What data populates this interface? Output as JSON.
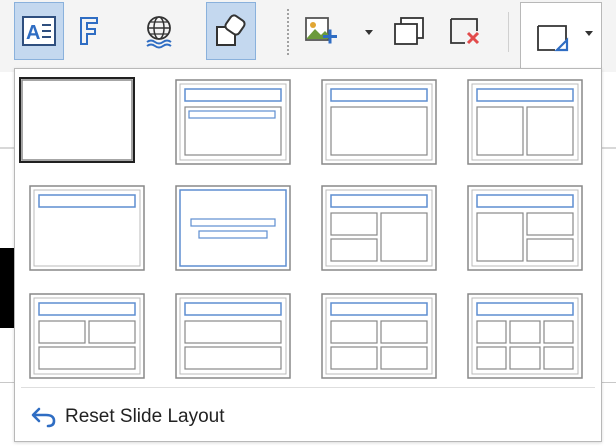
{
  "toolbar": {
    "buttons": [
      {
        "icon": "text-box-icon",
        "active": true
      },
      {
        "icon": "fontwork-icon",
        "active": false
      },
      {
        "icon": "web-globe-icon",
        "active": false
      },
      {
        "icon": "shapes-icon",
        "active": true
      },
      {
        "icon": "insert-image-icon",
        "active": false,
        "has_dropdown": true
      },
      {
        "icon": "duplicate-slide-icon",
        "active": false
      },
      {
        "icon": "delete-slide-icon",
        "active": false
      },
      {
        "icon": "slide-layout-icon",
        "active": false,
        "has_dropdown": true
      }
    ]
  },
  "colors": {
    "accent": "#2f6dc3",
    "active_bg": "#c4d8ef",
    "layout_border": "#888888",
    "layout_blue": "#5e8ed0"
  },
  "layout_popup": {
    "layouts": [
      {
        "name": "blank-slide",
        "selected": true
      },
      {
        "name": "title-content",
        "selected": false
      },
      {
        "name": "title-content-large",
        "selected": false
      },
      {
        "name": "title-2-content",
        "selected": false
      },
      {
        "name": "title-only",
        "selected": false
      },
      {
        "name": "centered-text",
        "selected": false
      },
      {
        "name": "title-2-content-and-content",
        "selected": false
      },
      {
        "name": "title-content-and-2-content",
        "selected": false
      },
      {
        "name": "title-2-content-over-content",
        "selected": false
      },
      {
        "name": "title-content-over-content",
        "selected": false
      },
      {
        "name": "title-4-content",
        "selected": false
      },
      {
        "name": "title-6-content",
        "selected": false
      }
    ],
    "reset_label": "Reset Slide Layout",
    "reset_icon": "undo-arrow-icon"
  }
}
